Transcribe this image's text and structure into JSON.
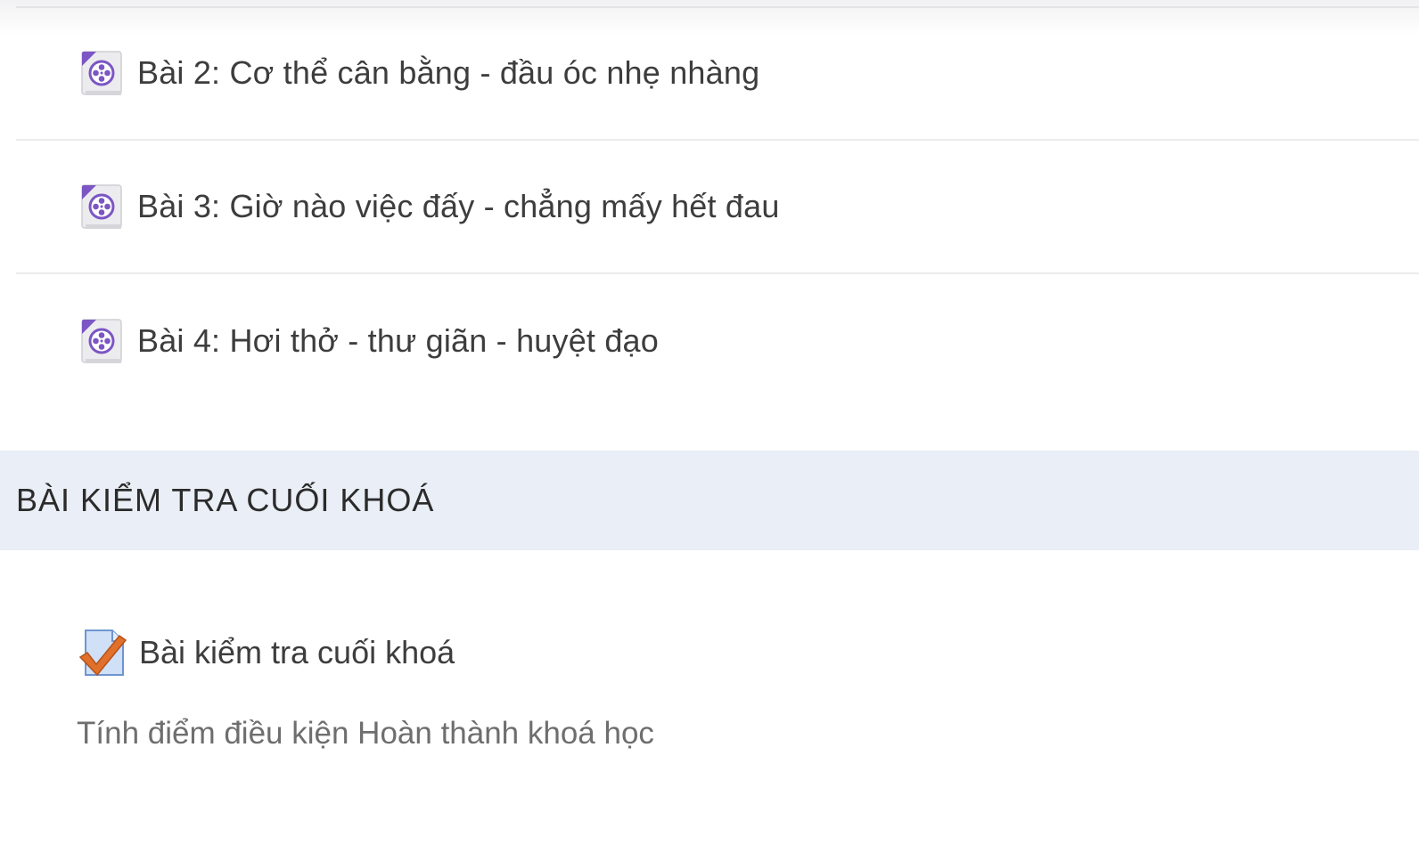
{
  "lessons": [
    {
      "label": "Bài 2: Cơ thể cân bằng - đầu óc nhẹ nhàng",
      "icon": "video-file-icon"
    },
    {
      "label": "Bài 3: Giờ nào việc đấy - chẳng mấy hết đau",
      "icon": "video-file-icon"
    },
    {
      "label": "Bài 4: Hơi thở - thư giãn - huyệt đạo",
      "icon": "video-file-icon"
    }
  ],
  "section": {
    "title": "BÀI KIỂM TRA CUỐI KHOÁ"
  },
  "quiz": {
    "label": "Bài kiểm tra cuối khoá",
    "icon": "quiz-checkmark-icon",
    "description": "Tính điểm điều kiện Hoàn thành khoá học"
  },
  "colors": {
    "section_background": "#eaeef6",
    "divider": "#ececee",
    "video_icon_accent": "#7b56c4",
    "quiz_check": "#e0702a",
    "quiz_page": "#cfe0f7"
  }
}
